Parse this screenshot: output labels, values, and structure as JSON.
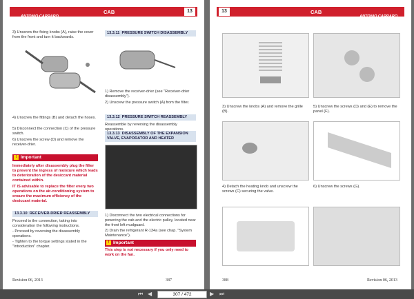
{
  "header": {
    "brand": "ANTONIO CARRARO",
    "section": "CAB",
    "page_num_left": "13",
    "page_num_right": "13"
  },
  "left": {
    "step3": {
      "num": "3)",
      "text": "Unscrew the fixing knobs (A), raise the cover from the front and turn it backwards."
    },
    "step4": {
      "num": "4)",
      "text": "Unscrew the fittings (B) and detach the hoses."
    },
    "step5": {
      "num": "5)",
      "text": "Disconnect the connection (C) of the pressure switch."
    },
    "step6": {
      "num": "6)",
      "text": "Unscrew the screw (D) and remove the receiver-drier."
    },
    "important_label": "Important",
    "important_text": "Immediately after disassembly plug the filter to prevent the ingress of moisture which leads to deterioration of the desiccant material contained within.",
    "important_text2": "IT IS advisable to replace the filter every two operations on the air-conditioning system to ensure the maximum efficiency of the desiccant material.",
    "s1310": {
      "num": "13.3.10",
      "title": "RECEIVER-DRIER REASSEMBLY"
    },
    "s1310_p1": "Proceed to the connection, taking into consideration the following instructions.",
    "s1310_b1": "- Proceed by reversing the disassembly operations.",
    "s1310_b2": "- Tighten to the torque settings stated in the \"Introduction\" chapter.",
    "s1311": {
      "num": "13.3.11",
      "title": "PRESSURE SWITCH DISASSEMBLY"
    },
    "s1311_1": {
      "num": "1)",
      "text": "Remove the receiver-drier (see \"Receiver-drier disassembly\")."
    },
    "s1311_2": {
      "num": "2)",
      "text": "Unscrew the pressure switch (A) from the filter."
    },
    "s1312": {
      "num": "13.3.12",
      "title": "PRESSURE SWITCH REASSEMBLY"
    },
    "s1312_p": "Reassemble by reversing the disassembly operations.",
    "s1313": {
      "num": "13.3.13",
      "title": "DISASSEMBLY OF THE EXPANSION VALVE, EVAPORATOR AND HEATER"
    },
    "s1313_1": {
      "num": "1)",
      "text": "Disconnect the two electrical connections for powering the cab and the electric pulley, located near the front left mudguard."
    },
    "s1313_2": {
      "num": "2)",
      "text": "Drain the refrigerant R-134a (see chap. \"System Maintenance\")."
    },
    "important2_label": "Important",
    "important2_text": "This step is not necessary if you only need to work on the fan.",
    "footer_left": "Revision 06, 2013",
    "footer_page": "387"
  },
  "right": {
    "r3": {
      "num": "3)",
      "text": "Unscrew the knobs (A) and remove the grille (B)."
    },
    "r4": {
      "num": "4)",
      "text": "Detach the heating knob and unscrew the screws (C) securing the valve."
    },
    "r5": {
      "num": "5)",
      "text": "Unscrew the screws (D) and (E) to remove the panel (F)."
    },
    "r6": {
      "num": "6)",
      "text": "Unscrew the screws (G)."
    },
    "footer_page": "388",
    "footer_right": "Revision 06, 2013"
  },
  "toolbar": {
    "page_indicator": "307 / 472"
  }
}
